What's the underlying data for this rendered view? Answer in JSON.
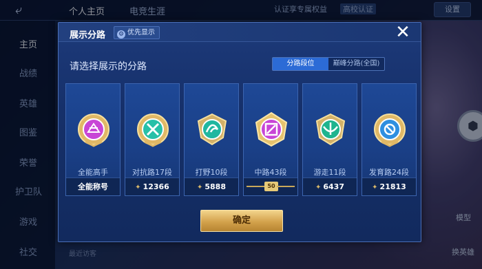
{
  "topbar": {
    "back_icon": "back-arrow-icon",
    "tabs": [
      "个人主页",
      "电竞生涯"
    ],
    "right_text": "认证享专属权益",
    "campus_badge": "高校认证",
    "settings": "设置"
  },
  "left_nav": {
    "items": [
      "主页",
      "战绩",
      "英雄",
      "图鉴",
      "荣誉",
      "护卫队",
      "游戏",
      "社交"
    ]
  },
  "bottom_hint": "最近访客",
  "right_labels": [
    "模型",
    "换英雄"
  ],
  "dialog": {
    "title": "展示分路",
    "priority_btn": "优先显示",
    "subtitle": "请选择展示的分路",
    "segments": [
      "分路段位",
      "巅峰分路(全国)"
    ],
    "active_segment": 0,
    "confirm": "确定",
    "close_icon": "close-icon"
  },
  "cards": [
    {
      "name": "全能高手",
      "footer": "全能称号",
      "icon": "all-round-emblem-icon",
      "color": "#c845d6",
      "rank_badge": null
    },
    {
      "name": "对抗路17段",
      "footer": "12366",
      "icon": "clash-lane-emblem-icon",
      "color": "#27c0a8",
      "rank_badge": null
    },
    {
      "name": "打野10段",
      "footer": "5888",
      "icon": "jungle-emblem-icon",
      "color": "#20b7a0",
      "rank_badge": null
    },
    {
      "name": "中路43段",
      "footer": "",
      "icon": "mid-lane-emblem-icon",
      "color": "#c845d6",
      "rank_badge": "50"
    },
    {
      "name": "游走11段",
      "footer": "6437",
      "icon": "roam-emblem-icon",
      "color": "#1eb48e",
      "rank_badge": null
    },
    {
      "name": "发育路24段",
      "footer": "21813",
      "icon": "farm-lane-emblem-icon",
      "color": "#2f8fe0",
      "rank_badge": null
    }
  ],
  "colors": {
    "accent": "#2c6bd6",
    "gold": "#d3a24c"
  }
}
